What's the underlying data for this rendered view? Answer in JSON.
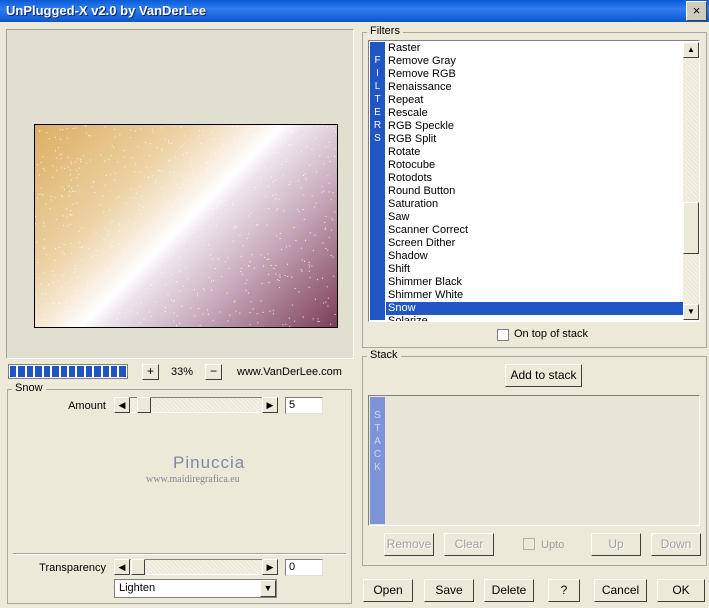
{
  "window": {
    "title": "UnPlugged-X v2.0 by VanDerLee",
    "close_label": "×"
  },
  "toolbar": {
    "zoom_in": "+",
    "zoom_value": "33%",
    "zoom_out": "−",
    "progress_fraction": 1.0,
    "website": "www.VanDerLee.com"
  },
  "snow": {
    "group_label": "Snow",
    "amount_label": "Amount",
    "amount_value": "5",
    "transparency_label": "Transparency",
    "transparency_value": "0",
    "blend_mode": "Lighten"
  },
  "watermark": {
    "line1": "Pinuccia",
    "line2": "www.maidiregrafica.eu"
  },
  "filters": {
    "group_label": "Filters",
    "side_label": "FILTERS",
    "items": [
      "Raster",
      "Remove Gray",
      "Remove RGB",
      "Renaissance",
      "Repeat",
      "Rescale",
      "RGB Speckle",
      "RGB Split",
      "Rotate",
      "Rotocube",
      "Rotodots",
      "Round Button",
      "Saturation",
      "Saw",
      "Scanner Correct",
      "Screen Dither",
      "Shadow",
      "Shift",
      "Shimmer Black",
      "Shimmer White",
      "Snow",
      "Solarize"
    ],
    "selected": "Snow",
    "on_top_label": "On top of stack"
  },
  "stack": {
    "group_label": "Stack",
    "side_label": "STACK",
    "add_label": "Add to stack",
    "remove_label": "Remove",
    "clear_label": "Clear",
    "upto_label": "Upto",
    "up_label": "Up",
    "down_label": "Down"
  },
  "footer": {
    "open": "Open",
    "save": "Save",
    "delete": "Delete",
    "help": "?",
    "cancel": "Cancel",
    "ok": "OK"
  },
  "colors": {
    "titlebar": "#0a5bd8",
    "selection": "#2256c4",
    "filters_side": "#2055c4",
    "stack_side": "#7d95d8"
  },
  "icons": {
    "close": "close-icon",
    "scroll_up": "arrow-up-icon",
    "scroll_down": "arrow-down-icon",
    "left": "arrow-left-icon",
    "right": "arrow-right-icon",
    "dropdown": "chevron-down-icon"
  }
}
